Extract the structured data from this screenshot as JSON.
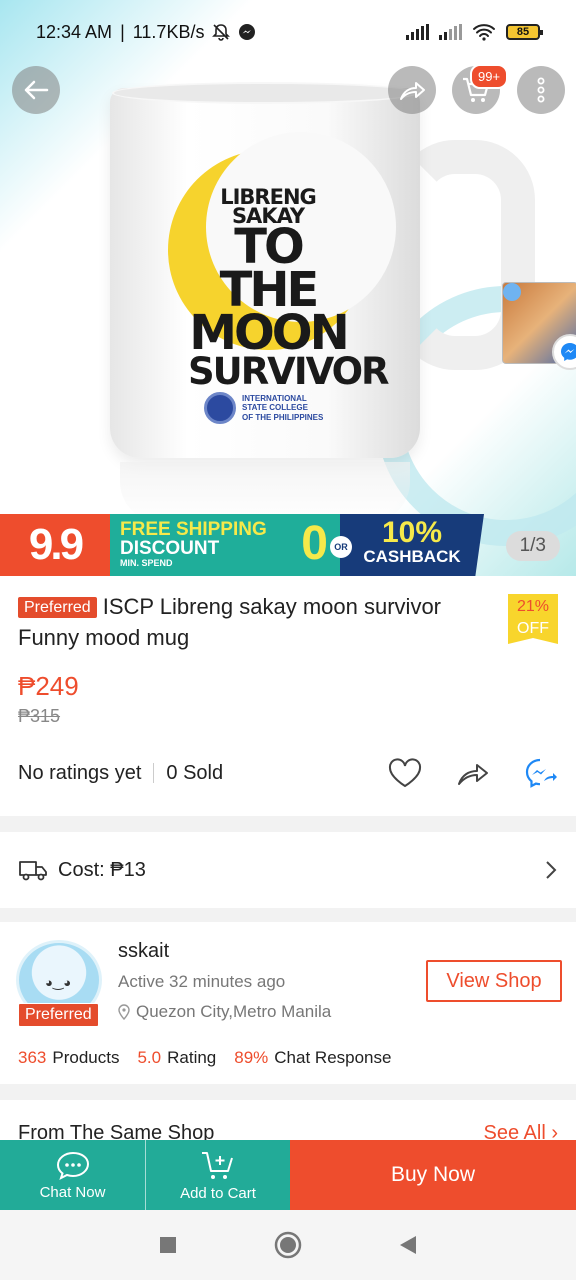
{
  "status_bar": {
    "time": "12:34 AM",
    "speed": "11.7KB/s",
    "battery": "85"
  },
  "hero": {
    "mug_text": {
      "line1": "LIBRENG SAKAY",
      "line2": "TO THE",
      "line3": "MOON",
      "line4": "SURVIVOR"
    },
    "college_lines": [
      "INTERNATIONAL",
      "STATE COLLEGE",
      "OF THE PHILIPPINES"
    ],
    "cart_badge": "99+",
    "page_indicator": "1/3"
  },
  "promo": {
    "sale": "9.9",
    "free_shipping": "FREE SHIPPING",
    "discount": "DISCOUNT",
    "min_spend": "MIN. SPEND",
    "zero": "0",
    "or": "OR",
    "cashback_percent": "10%",
    "cashback": "CASHBACK"
  },
  "product": {
    "badge": "Preferred",
    "title": "ISCP Libreng sakay moon survivor Funny mood mug",
    "discount_percent": "21%",
    "discount_label": "OFF",
    "price": "₱249",
    "original_price": "₱315",
    "ratings": "No ratings yet",
    "sold": "0 Sold"
  },
  "shipping": {
    "cost_label": "Cost: ₱13"
  },
  "shop": {
    "name": "sskait",
    "active": "Active 32 minutes ago",
    "location": "Quezon City,Metro Manila",
    "badge": "Preferred",
    "view_shop": "View Shop",
    "stats": [
      {
        "value": "363",
        "label": "Products"
      },
      {
        "value": "5.0",
        "label": "Rating"
      },
      {
        "value": "89%",
        "label": "Chat Response"
      }
    ]
  },
  "same_shop": {
    "title": "From The Same Shop",
    "see_all": "See All"
  },
  "bottom_bar": {
    "chat_now": "Chat Now",
    "add_to_cart": "Add to Cart",
    "buy_now": "Buy Now"
  },
  "colors": {
    "accent": "#ee4d2d",
    "teal": "#22ab98"
  }
}
